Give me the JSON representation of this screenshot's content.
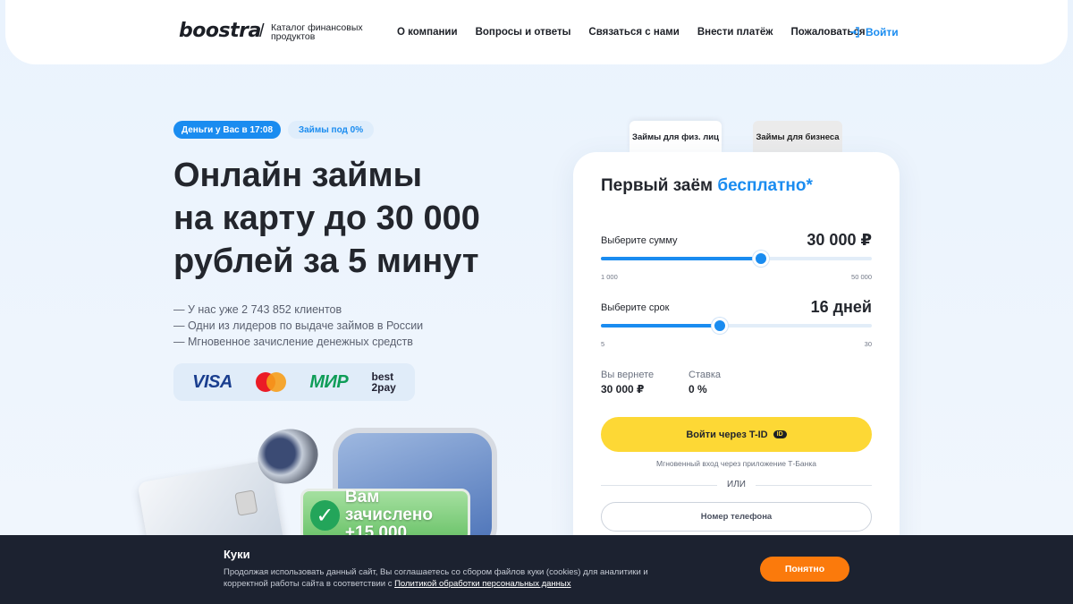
{
  "header": {
    "logo": "boostra",
    "logo_separator": "/",
    "logo_subtitle": "Каталог финансовых продуктов",
    "nav": [
      "О компании",
      "Вопросы и ответы",
      "Связаться с нами",
      "Внести платёж",
      "Пожаловаться"
    ],
    "login_label": "Войти"
  },
  "hero": {
    "badges": [
      "Деньги у Вас в 17:08",
      "Займы под 0%"
    ],
    "title_lines": [
      "Онлайн займы",
      "на карту до 30 000",
      "рублей за 5 минут"
    ],
    "bullets": [
      "— У нас уже 2 743 852 клиентов",
      "— Одни из лидеров по выдаче займов в России",
      "— Мгновенное зачисление денежных средств"
    ],
    "payment_logos": [
      "VISA",
      "mastercard",
      "МИР",
      "best2pay"
    ],
    "payment_text": {
      "visa": "VISA",
      "mir": "МИР",
      "bestpay_1": "best",
      "bestpay_2": "2pay"
    },
    "illustration": {
      "banner_line1": "Вам зачислено",
      "banner_line2": "+15 000"
    }
  },
  "tabs": [
    "Займы для физ. лиц",
    "Займы для бизнеса"
  ],
  "form": {
    "title_main": "Первый заём",
    "title_accent": "бесплатно*",
    "amount": {
      "label": "Выберите сумму",
      "value": "30 000 ₽",
      "min": "1 000",
      "max": "50 000",
      "current": 30000,
      "min_num": 1000,
      "max_num": 50000
    },
    "term": {
      "label": "Выберите срок",
      "value": "16 дней",
      "min": "5",
      "max": "30",
      "current": 16,
      "min_num": 5,
      "max_num": 30
    },
    "return_label": "Вы вернете",
    "return_value": "30 000 ₽",
    "rate_label": "Ставка",
    "rate_value": "0 %",
    "tid_button": "Войти через T-ID",
    "tid_badge": "ID",
    "tid_hint": "Мгновенный вход через приложение Т-Банка",
    "or_label": "ИЛИ",
    "phone_button": "Номер телефона"
  },
  "cookie": {
    "title": "Куки",
    "text": "Продолжая использовать данный сайт, Вы соглашаетесь со сбором файлов куки (cookies) для аналитики и корректной работы сайта в соответствии с ",
    "link": "Политикой обработки персональных данных",
    "button": "Понятно"
  },
  "colors": {
    "accent": "#1a8cf0",
    "yellow": "#fdd835",
    "orange": "#fb7a0c",
    "dark": "#1c2230"
  }
}
